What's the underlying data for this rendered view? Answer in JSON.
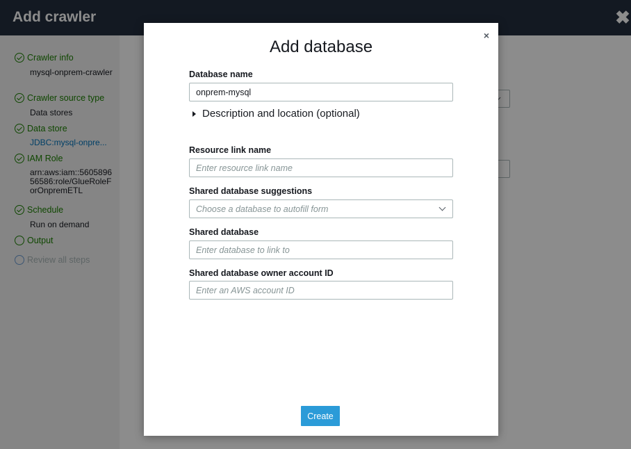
{
  "page": {
    "title": "Add crawler",
    "close_label": "✖"
  },
  "sidebar": {
    "steps": [
      {
        "label": "Crawler info",
        "status": "done",
        "detail": "mysql-onprem-crawler"
      },
      {
        "label": "Crawler source type",
        "status": "done",
        "detail": "Data stores"
      },
      {
        "label": "Data store",
        "status": "done",
        "detail": "JDBC:mysql-onpre..."
      },
      {
        "label": "IAM Role",
        "status": "done",
        "detail": "arn:aws:iam::560589656586:role/GlueRoleForOnpremETL"
      },
      {
        "label": "Schedule",
        "status": "done",
        "detail": "Run on demand"
      },
      {
        "label": "Output",
        "status": "current",
        "detail": ""
      },
      {
        "label": "Review all steps",
        "status": "disabled",
        "detail": ""
      }
    ]
  },
  "modal": {
    "title": "Add database",
    "close_label": "×",
    "database_name": {
      "label": "Database name",
      "value": "onprem-mysql"
    },
    "description_toggle": "Description and location (optional)",
    "resource_link": {
      "label": "Resource link name",
      "placeholder": "Enter resource link name"
    },
    "shared_suggestions": {
      "label": "Shared database suggestions",
      "placeholder": "Choose a database to autofill form"
    },
    "shared_database": {
      "label": "Shared database",
      "placeholder": "Enter database to link to"
    },
    "owner_account": {
      "label": "Shared database owner account ID",
      "placeholder": "Enter an AWS account ID"
    },
    "create_label": "Create"
  },
  "colors": {
    "header_bg": "#232f3e",
    "success_green": "#1d8102",
    "link_blue": "#0073bb",
    "primary_button": "#2b9bd8"
  }
}
